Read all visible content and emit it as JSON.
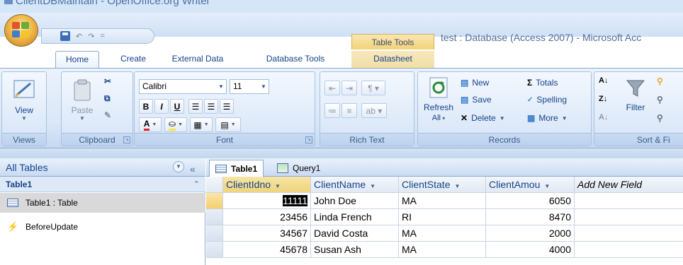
{
  "top_title": "ClientDBMaintain - OpenOffice.org Writer",
  "quick_access": {
    "undo": "↶",
    "redo": "↷",
    "customize": "="
  },
  "context_tab": "Table Tools",
  "window_title": "test : Database (Access 2007) - Microsoft Acc",
  "tabs": [
    "Home",
    "Create",
    "External Data",
    "Database Tools",
    "Datasheet"
  ],
  "ribbon": {
    "views": {
      "label": "Views",
      "view": "View"
    },
    "clipboard": {
      "label": "Clipboard",
      "paste": "Paste"
    },
    "font": {
      "label": "Font",
      "family": "Calibri",
      "size": "11",
      "bold": "B",
      "italic": "I",
      "underline": "U",
      "color_a": "A"
    },
    "rich_text": {
      "label": "Rich Text"
    },
    "records": {
      "label": "Records",
      "refresh": "Refresh",
      "refresh_sub": "All",
      "new": "New",
      "save": "Save",
      "delete": "Delete",
      "totals": "Totals",
      "spelling": "Spelling",
      "more": "More"
    },
    "sort_filter": {
      "label": "Sort & Fi",
      "filter": "Filter"
    }
  },
  "nav": {
    "header": "All Tables",
    "group": "Table1",
    "items": [
      "Table1 : Table",
      "BeforeUpdate"
    ]
  },
  "doc_tabs": [
    "Table1",
    "Query1"
  ],
  "datasheet": {
    "columns": [
      "ClientIdno",
      "ClientName",
      "ClientState",
      "ClientAmou",
      "Add New Field"
    ],
    "rows": [
      [
        "11111",
        "John Doe",
        "MA",
        "6050"
      ],
      [
        "23456",
        "Linda French",
        "RI",
        "8470"
      ],
      [
        "34567",
        "David Costa",
        "MA",
        "2000"
      ],
      [
        "45678",
        "Susan Ash",
        "MA",
        "4000"
      ]
    ]
  }
}
